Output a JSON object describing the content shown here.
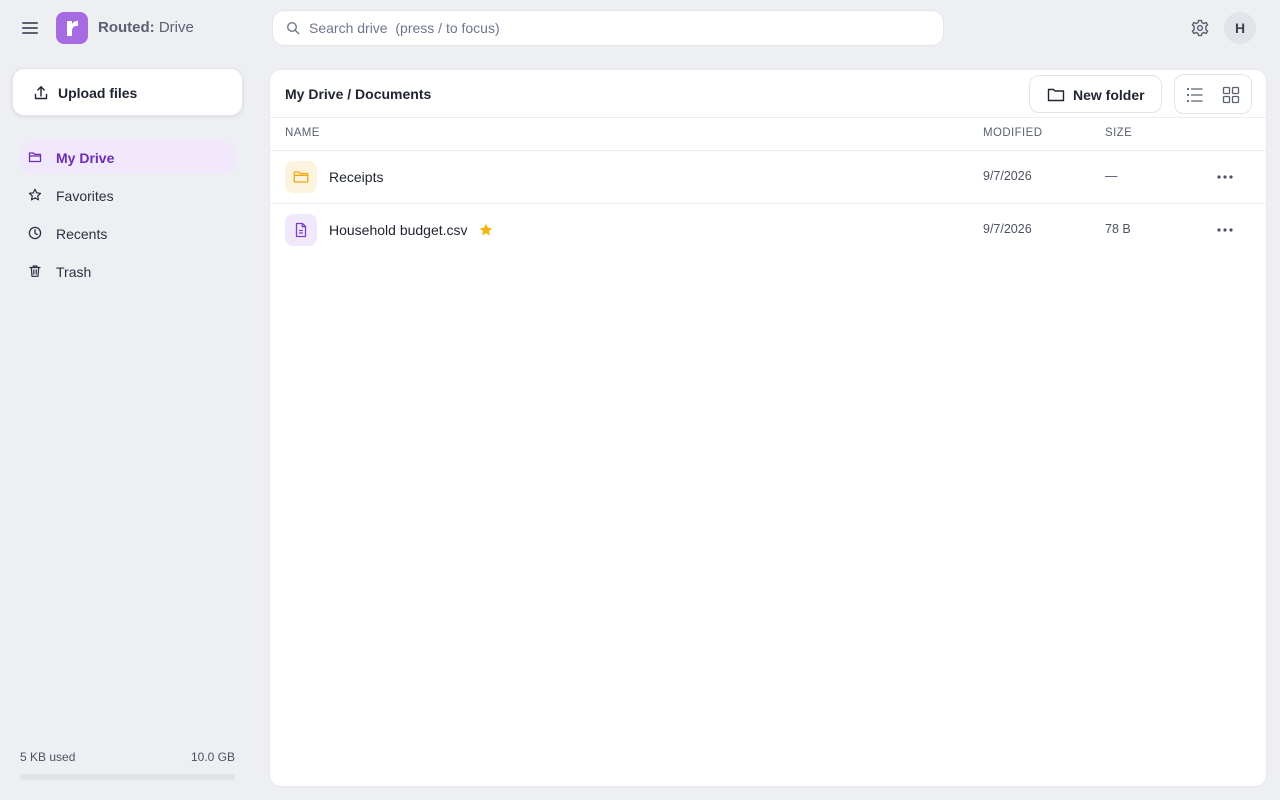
{
  "header": {
    "brand_bold": "Routed:",
    "brand_rest": " Drive",
    "search_placeholder": "Search drive  (press / to focus)",
    "avatar_initial": "H",
    "accent_color": "#a46ce0"
  },
  "sidebar": {
    "upload_label": "Upload files",
    "items": [
      {
        "label": "My Drive",
        "icon": "folder-icon",
        "active": true
      },
      {
        "label": "Favorites",
        "icon": "star-icon",
        "active": false
      },
      {
        "label": "Recents",
        "icon": "clock-icon",
        "active": false
      },
      {
        "label": "Trash",
        "icon": "trash-icon",
        "active": false
      }
    ],
    "storage": {
      "used_label": "5 KB used",
      "total_label": "10.0 GB",
      "used_fraction": 5e-07
    }
  },
  "main": {
    "breadcrumb": "My Drive / Documents",
    "new_folder_label": "New folder",
    "columns": {
      "name": "NAME",
      "modified": "MODIFIED",
      "size": "SIZE"
    },
    "files": [
      {
        "name": "Receipts",
        "type": "folder",
        "icon": "folder-icon",
        "modified": "9/7/2026",
        "size": "—",
        "starred": false
      },
      {
        "name": "Household budget.csv",
        "type": "file",
        "icon": "file-icon",
        "modified": "9/7/2026",
        "size": "78 B",
        "starred": true
      }
    ]
  },
  "colors": {
    "folder": "#f0a915",
    "file": "#7b3fc4",
    "star": "#f6b40e",
    "active_nav_bg": "#f1e8fc"
  }
}
